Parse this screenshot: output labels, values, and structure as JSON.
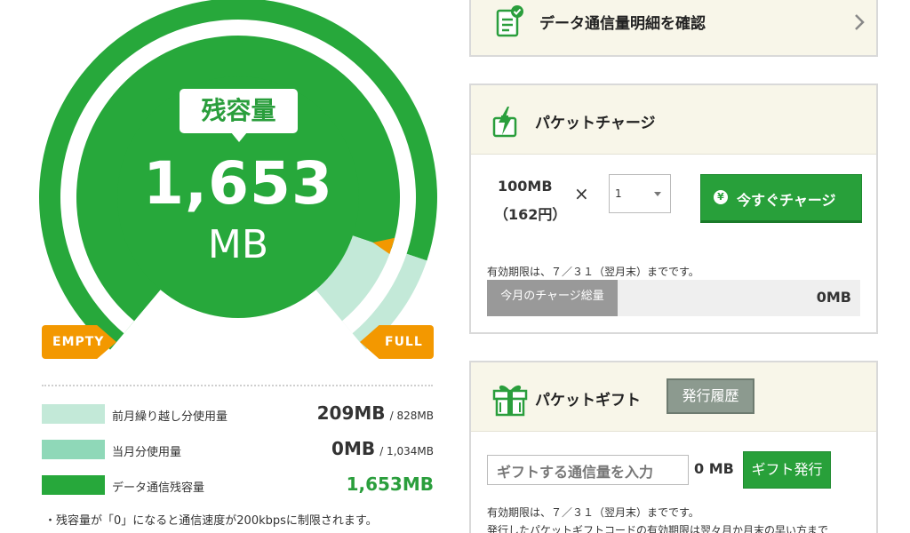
{
  "remaining": {
    "label": "残容量",
    "value": "1,653",
    "unit": "MB",
    "tag_empty": "EMPTY",
    "tag_full": "FULL"
  },
  "gauge": {
    "remaining_mb": 1653,
    "prev_month_capacity_mb": 828,
    "current_month_capacity_mb": 1034,
    "colors": {
      "remaining": "#27a83b",
      "prev_carryover_used": "#c3e9d8",
      "current_used": "#8fd8b8",
      "marker": "#f39800"
    }
  },
  "legend": [
    {
      "label": "前月繰り越し分使用量",
      "value": "209MB",
      "max": "/ 828MB",
      "color": "#c3e9d8"
    },
    {
      "label": "当月分使用量",
      "value": "0MB",
      "max": "/ 1,034MB",
      "color": "#8fd8b8"
    },
    {
      "label": "データ通信残容量",
      "value": "1,653MB",
      "max": "",
      "color": "#27a83b"
    }
  ],
  "note": "・残容量が「0」になると通信速度が200kbpsに制限されます。",
  "detail": {
    "title": "データ通信量明細を確認"
  },
  "charge": {
    "title": "パケットチャージ",
    "price_mb": "100MB",
    "price_yen": "（162円）",
    "times": "×",
    "qty": "1",
    "button": "今すぐチャージ",
    "yen_symbol": "¥",
    "expiry": "有効期限は、７／３１（翌月末）までです。",
    "total_label": "今月のチャージ総量",
    "total_value": "0MB"
  },
  "gift": {
    "title": "パケットギフト",
    "history_button": "発行履歴",
    "input_placeholder": "ギフトする通信量を入力",
    "mb": "0 MB",
    "issue_button": "ギフト発行",
    "expiry": "有効期限は、７／３１（翌月末）までです。",
    "note": "発行したパケットギフトコードの有効期限は翌々月か月末の早い方まで"
  }
}
